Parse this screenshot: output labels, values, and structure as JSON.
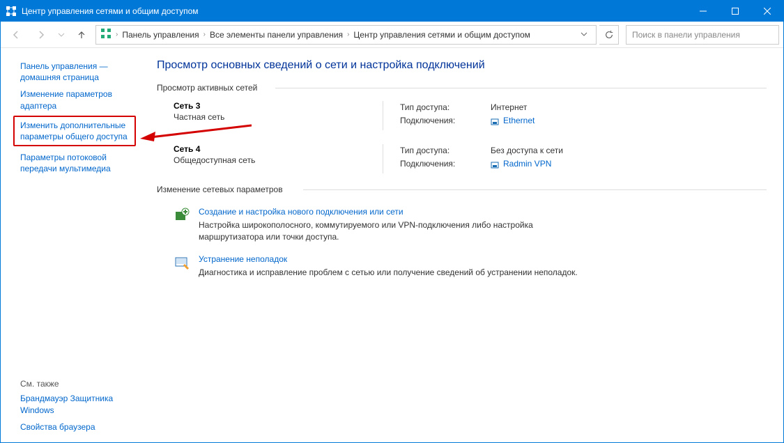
{
  "titlebar": {
    "title": "Центр управления сетями и общим доступом"
  },
  "breadcrumb": {
    "items": [
      "Панель управления",
      "Все элементы панели управления",
      "Центр управления сетями и общим доступом"
    ]
  },
  "search": {
    "placeholder": "Поиск в панели управления"
  },
  "sidebar": {
    "links": [
      "Панель управления — домашняя страница",
      "Изменение параметров адаптера",
      "Изменить дополнительные параметры общего доступа",
      "Параметры потоковой передачи мультимедиа"
    ],
    "seealso_label": "См. также",
    "seealso": [
      "Брандмауэр Защитника Windows",
      "Свойства браузера"
    ]
  },
  "main": {
    "page_title": "Просмотр основных сведений о сети и настройка подключений",
    "active_networks_label": "Просмотр активных сетей",
    "access_type_label": "Тип доступа:",
    "connections_label": "Подключения:",
    "networks": [
      {
        "name": "Сеть 3",
        "type": "Частная сеть",
        "access": "Интернет",
        "conn": "Ethernet"
      },
      {
        "name": "Сеть 4",
        "type": "Общедоступная сеть",
        "access": "Без доступа к сети",
        "conn": "Radmin VPN"
      }
    ],
    "change_label": "Изменение сетевых параметров",
    "change_items": [
      {
        "title": "Создание и настройка нового подключения или сети",
        "desc": "Настройка широкополосного, коммутируемого или VPN-подключения либо настройка маршрутизатора или точки доступа."
      },
      {
        "title": "Устранение неполадок",
        "desc": "Диагностика и исправление проблем с сетью или получение сведений об устранении неполадок."
      }
    ]
  }
}
